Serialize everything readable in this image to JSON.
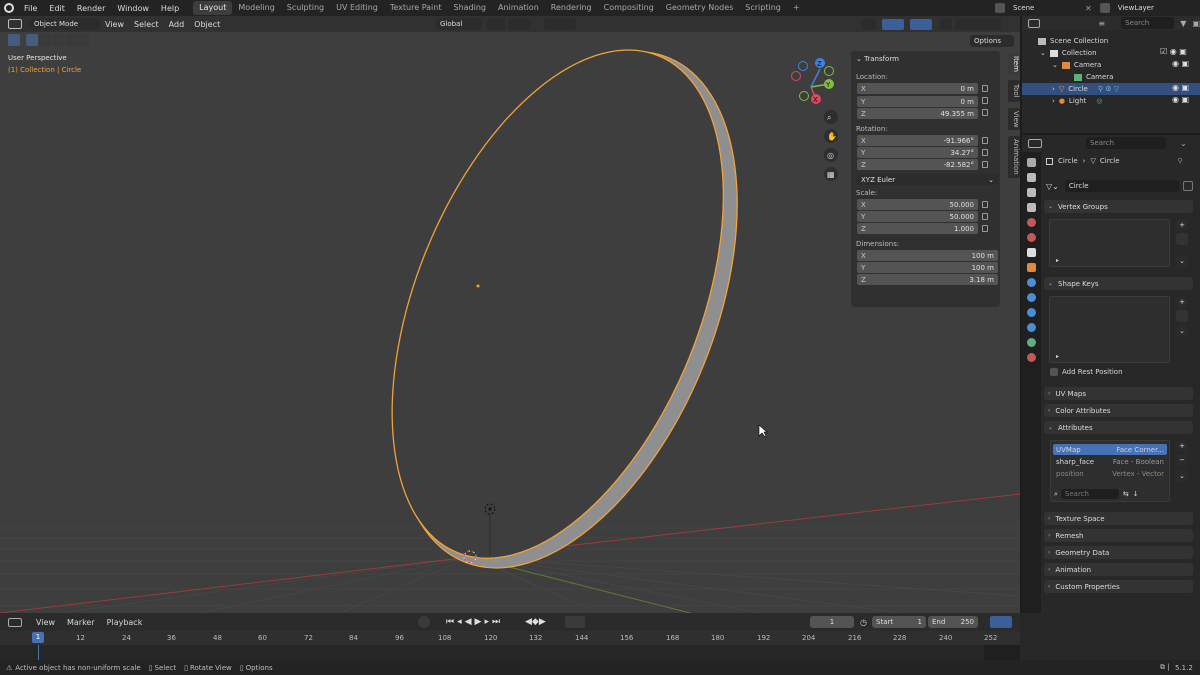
{
  "topbar": {
    "menus": [
      "File",
      "Edit",
      "Render",
      "Window",
      "Help"
    ],
    "workspaces": [
      "Layout",
      "Modeling",
      "Sculpting",
      "UV Editing",
      "Texture Paint",
      "Shading",
      "Animation",
      "Rendering",
      "Compositing",
      "Geometry Nodes",
      "Scripting"
    ],
    "active_workspace": "Layout",
    "add_tab": "+",
    "scene": "Scene",
    "view_layer": "ViewLayer"
  },
  "viewport_header": {
    "mode": "Object Mode",
    "menus": [
      "View",
      "Select",
      "Add",
      "Object"
    ],
    "orientation": "Global",
    "options": "Options"
  },
  "viewport": {
    "perspective_label": "User Perspective",
    "collection_label": "(1) Collection | Circle",
    "gizmo_axes": [
      "X",
      "Y",
      "Z"
    ]
  },
  "npanel": {
    "section": "Transform",
    "location_label": "Location:",
    "location": [
      {
        "axis": "X",
        "value": "0 m"
      },
      {
        "axis": "Y",
        "value": "0 m"
      },
      {
        "axis": "Z",
        "value": "49.355 m"
      }
    ],
    "rotation_label": "Rotation:",
    "rotation": [
      {
        "axis": "X",
        "value": "-91.966°"
      },
      {
        "axis": "Y",
        "value": "34.27°"
      },
      {
        "axis": "Z",
        "value": "-82.582°"
      }
    ],
    "rotation_mode": "XYZ Euler",
    "scale_label": "Scale:",
    "scale": [
      {
        "axis": "X",
        "value": "50.000"
      },
      {
        "axis": "Y",
        "value": "50.000"
      },
      {
        "axis": "Z",
        "value": "1.000"
      }
    ],
    "dimensions_label": "Dimensions:",
    "dimensions": [
      {
        "axis": "X",
        "value": "100 m"
      },
      {
        "axis": "Y",
        "value": "100 m"
      },
      {
        "axis": "Z",
        "value": "3.18 m"
      }
    ],
    "tabs": [
      "Item",
      "Tool",
      "View",
      "Animation"
    ]
  },
  "outliner": {
    "search_placeholder": "Search",
    "items": [
      {
        "label": "Scene Collection"
      },
      {
        "label": "Collection"
      },
      {
        "label": "Camera"
      },
      {
        "label": "Camera"
      },
      {
        "label": "Circle"
      },
      {
        "label": "Light"
      }
    ]
  },
  "properties": {
    "search_placeholder": "Search",
    "breadcrumb_object": "Circle",
    "breadcrumb_data": "Circle",
    "data_name": "Circle",
    "sections": {
      "vertex_groups": "Vertex Groups",
      "shape_keys": "Shape Keys",
      "add_rest_position": "Add Rest Position",
      "uv_maps": "UV Maps",
      "color_attributes": "Color Attributes",
      "attributes": "Attributes",
      "texture_space": "Texture Space",
      "remesh": "Remesh",
      "geometry_data": "Geometry Data",
      "animation": "Animation",
      "custom_properties": "Custom Properties"
    },
    "attributes": [
      {
        "name": "UVMap",
        "domain": "Face Corner..."
      },
      {
        "name": "sharp_face",
        "domain": "Face - Boolean"
      },
      {
        "name": "position",
        "domain": "Vertex - Vector"
      }
    ],
    "attr_search_placeholder": "Search"
  },
  "timeline": {
    "menus": [
      "View",
      "Marker",
      "Playback"
    ],
    "current_frame": "1",
    "start_label": "Start",
    "start": "1",
    "end_label": "End",
    "end": "250",
    "ticks": [
      "12",
      "24",
      "36",
      "48",
      "60",
      "72",
      "84",
      "96",
      "108",
      "120",
      "132",
      "144",
      "156",
      "168",
      "180",
      "192",
      "204",
      "216",
      "228",
      "240",
      "252"
    ],
    "playhead": "1"
  },
  "statusbar": {
    "message": "Active object has non-uniform scale",
    "select": "Select",
    "rotate_view": "Rotate View",
    "options": "Options",
    "version": "5.1.2"
  },
  "colors": {
    "accent": "#4772b3",
    "selection_orange": "#f0a23b",
    "x_axis": "#e0465d",
    "y_axis": "#7fbf3d",
    "z_axis": "#3d82e0"
  }
}
